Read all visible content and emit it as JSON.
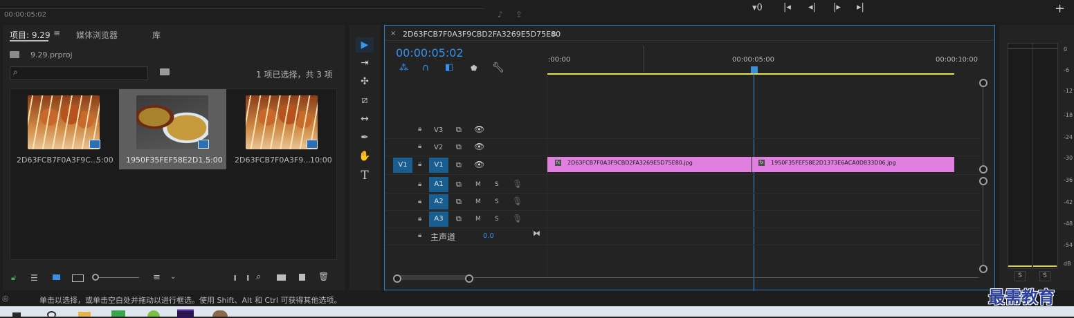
{
  "source_monitor": {
    "timecode": "00:00:05:02"
  },
  "project_panel": {
    "tabs": [
      "项目: 9.29",
      "媒体浏览器",
      "库"
    ],
    "project_file": "9.29.prproj",
    "selection_status": "1 项已选择，共 3 项",
    "items": [
      {
        "name": "2D63FCB7F0A3F9C...",
        "duration": "5:00"
      },
      {
        "name": "1950F35FEF58E2D1...",
        "duration": "5:00"
      },
      {
        "name": "2D63FCB7F0A3F9...",
        "duration": "10:00"
      }
    ]
  },
  "timeline": {
    "sequence_name": "2D63FCB7F0A3F9CBD2FA3269E5D75E80",
    "timecode": "00:00:05:02",
    "ruler_labels": [
      ":00:00",
      "00:00:05:00",
      "00:00:10:00"
    ],
    "video_tracks": [
      {
        "source": "",
        "name": "V3"
      },
      {
        "source": "",
        "name": "V2"
      },
      {
        "source": "V1",
        "name": "V1"
      }
    ],
    "audio_tracks": [
      {
        "name": "A1",
        "m": "M",
        "s": "S"
      },
      {
        "name": "A2",
        "m": "M",
        "s": "S"
      },
      {
        "name": "A3",
        "m": "M",
        "s": "S"
      }
    ],
    "master": {
      "label": "主声道",
      "value": "0.0"
    },
    "clips": [
      {
        "label": "2D63FCB7F0A3F9CBD2FA3269E5D75E80.jpg",
        "fx": "fx"
      },
      {
        "label": "1950F35FEF58E2D1373E6ACA0D833D06.jpg",
        "fx": "fx"
      }
    ],
    "clip_color": "#e07fe0"
  },
  "audio_meter": {
    "ticks": [
      "0",
      "-6",
      "-12",
      "-18",
      "-24",
      "-30",
      "-36",
      "-42",
      "-48",
      "-54",
      "dB"
    ],
    "solo_labels": [
      "S",
      "S"
    ]
  },
  "status_bar": {
    "hint": "单击以选择，或单击空白处并拖动以进行框选。使用 Shift、Alt 和 Ctrl 可获得其他选项。"
  },
  "watermark": "最需教育",
  "colors": {
    "accent": "#2d8ceb",
    "playhead": "#3a8fd8",
    "work_area": "#e9e24c",
    "track_target": "#1a5d8f"
  }
}
